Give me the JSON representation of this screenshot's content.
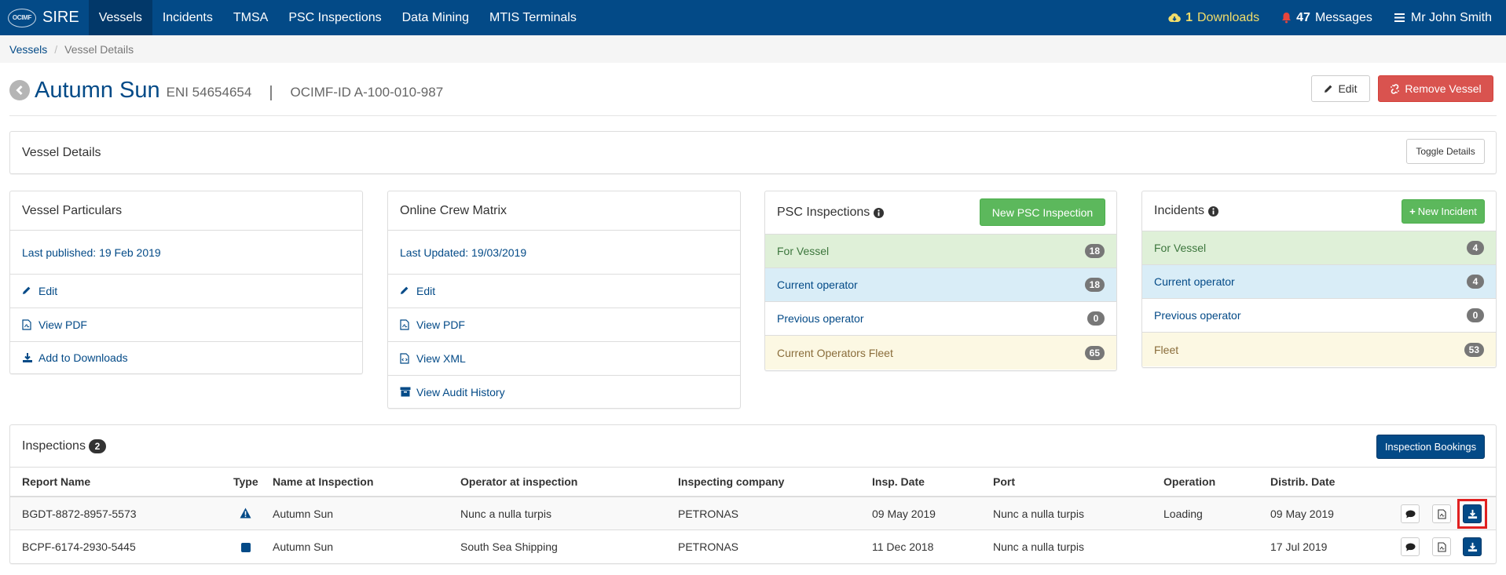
{
  "nav": {
    "logo_text": "OCIMF",
    "brand": "SIRE",
    "items": [
      "Vessels",
      "Incidents",
      "TMSA",
      "PSC Inspections",
      "Data Mining",
      "MTIS Terminals"
    ],
    "downloads_count": "1",
    "downloads_label": "Downloads",
    "messages_count": "47",
    "messages_label": "Messages",
    "user": "Mr John Smith"
  },
  "breadcrumb": {
    "vessels": "Vessels",
    "sep": "/",
    "current": "Vessel Details"
  },
  "vessel": {
    "name": "Autumn Sun",
    "eni": "ENI 54654654",
    "divider": "|",
    "ocimf_id": "OCIMF-ID  A-100-010-987",
    "edit_label": "Edit",
    "remove_label": "Remove Vessel"
  },
  "details_panel": {
    "title": "Vessel Details",
    "toggle_label": "Toggle Details"
  },
  "particulars": {
    "title": "Vessel Particulars",
    "last_published": "Last published: 19 Feb 2019",
    "edit": "Edit",
    "view_pdf": "View PDF",
    "add_downloads": "Add to Downloads"
  },
  "crew_matrix": {
    "title": "Online Crew Matrix",
    "last_updated": "Last Updated: 19/03/2019",
    "edit": "Edit",
    "view_pdf": "View PDF",
    "view_xml": "View XML",
    "view_audit": "View Audit History"
  },
  "psc": {
    "title": "PSC Inspections",
    "new_label": "New PSC Inspection",
    "rows": [
      {
        "label": "For Vessel",
        "count": "18"
      },
      {
        "label": "Current operator",
        "count": "18"
      },
      {
        "label": "Previous operator",
        "count": "0"
      },
      {
        "label": "Current Operators Fleet",
        "count": "65"
      }
    ]
  },
  "incidents": {
    "title": "Incidents",
    "new_label": "New Incident",
    "rows": [
      {
        "label": "For Vessel",
        "count": "4"
      },
      {
        "label": "Current operator",
        "count": "4"
      },
      {
        "label": "Previous operator",
        "count": "0"
      },
      {
        "label": "Fleet",
        "count": "53"
      }
    ]
  },
  "inspections": {
    "title": "Inspections",
    "count": "2",
    "bookings_label": "Inspection Bookings",
    "columns": [
      "Report Name",
      "Type",
      "Name at Inspection",
      "Operator at inspection",
      "Inspecting company",
      "Insp. Date",
      "Port",
      "Operation",
      "Distrib. Date"
    ],
    "rows": [
      {
        "report": "BGDT-8872-8957-5573",
        "type_icon": "warning-triangle-icon",
        "name": "Autumn Sun",
        "operator": "Nunc a nulla turpis",
        "company": "PETRONAS",
        "insp_date": "09 May 2019",
        "port": "Nunc a nulla turpis",
        "operation": "Loading",
        "distrib_date": "09 May 2019"
      },
      {
        "report": "BCPF-6174-2930-5445",
        "type_icon": "square-icon",
        "name": "Autumn Sun",
        "operator": "South Sea Shipping",
        "company": "PETRONAS",
        "insp_date": "11 Dec 2018",
        "port": "Nunc a nulla turpis",
        "operation": "",
        "distrib_date": "17 Jul 2019"
      }
    ]
  },
  "colors": {
    "brand": "#034a87",
    "danger": "#d9534f",
    "success": "#5cb85c",
    "highlight": "#e02020"
  }
}
